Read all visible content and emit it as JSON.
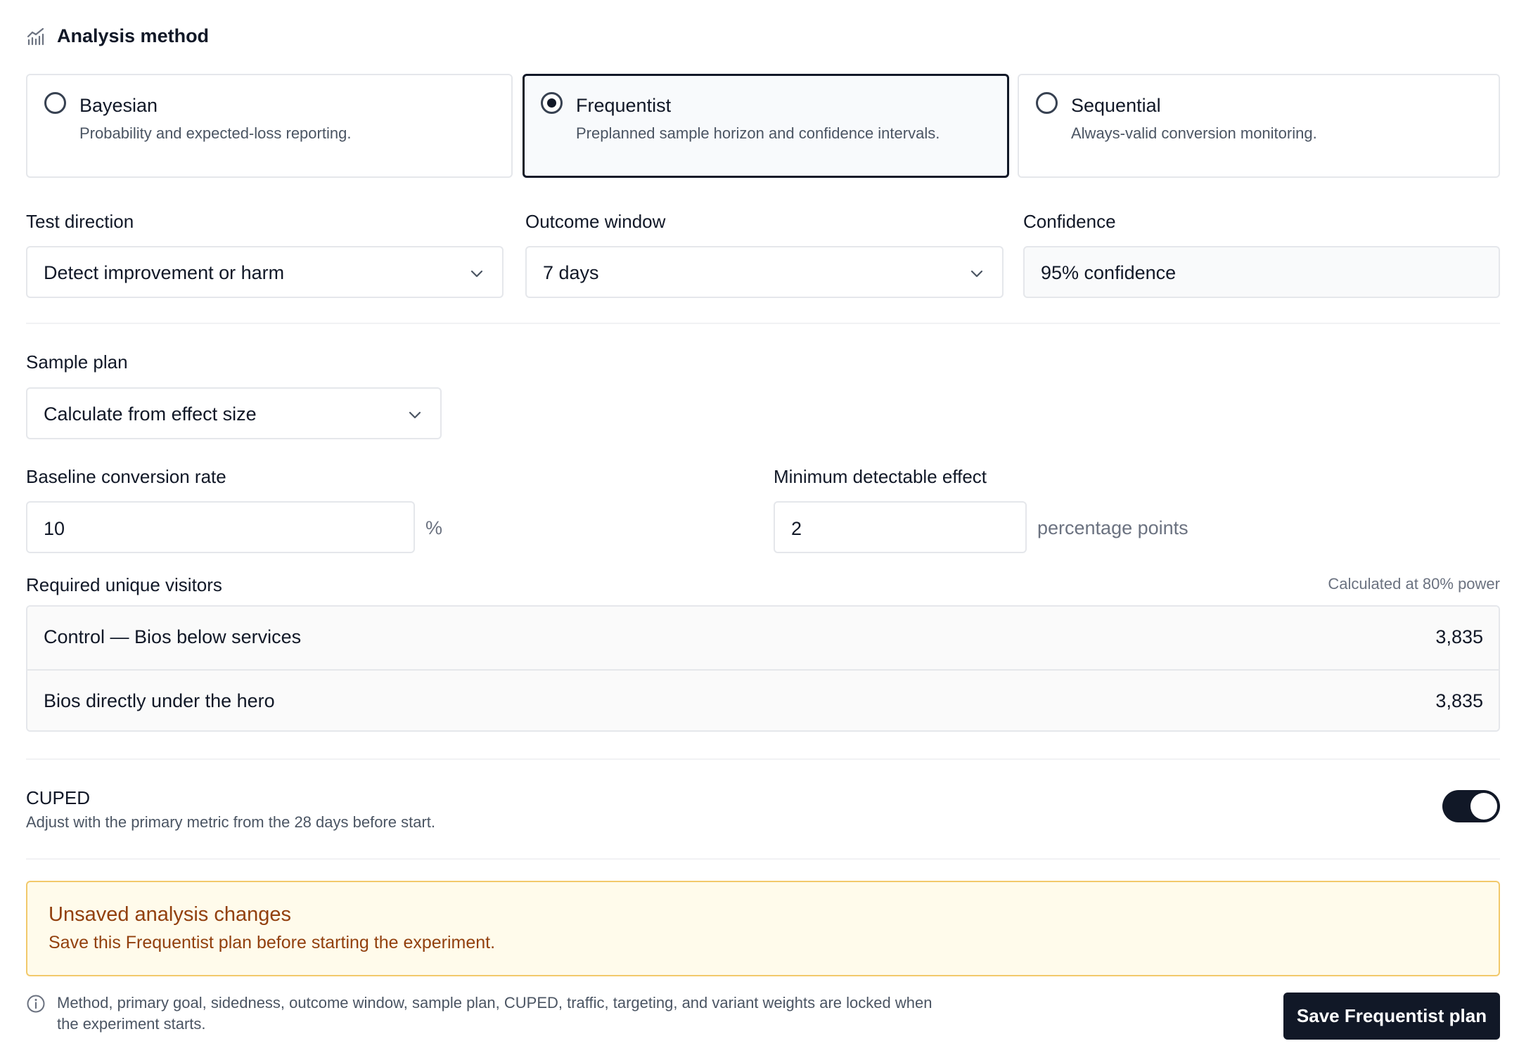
{
  "section": {
    "title": "Analysis method",
    "icon": "chart-icon"
  },
  "methods": [
    {
      "name": "Bayesian",
      "description": "Probability and expected-loss reporting.",
      "selected": false
    },
    {
      "name": "Frequentist",
      "description": "Preplanned sample horizon and confidence intervals.",
      "selected": true
    },
    {
      "name": "Sequential",
      "description": "Always-valid conversion monitoring.",
      "selected": false
    }
  ],
  "test_direction": {
    "label": "Test direction",
    "value": "Detect improvement or harm"
  },
  "outcome_window": {
    "label": "Outcome window",
    "value": "7 days"
  },
  "confidence": {
    "label": "Confidence",
    "value": "95% confidence"
  },
  "sample_plan": {
    "label": "Sample plan",
    "value": "Calculate from effect size"
  },
  "baseline": {
    "label": "Baseline conversion rate",
    "value": "10",
    "unit": "%"
  },
  "mde": {
    "label": "Minimum detectable effect",
    "value": "2",
    "unit": "percentage points"
  },
  "required_visitors": {
    "label": "Required unique visitors",
    "note": "Calculated at 80% power",
    "rows": [
      {
        "label": "Control — Bios below services",
        "value": "3,835"
      },
      {
        "label": "Bios directly under the hero",
        "value": "3,835"
      }
    ]
  },
  "cuped": {
    "title": "CUPED",
    "description": "Adjust with the primary metric from the 28 days before start.",
    "enabled": true
  },
  "warning": {
    "title": "Unsaved analysis changes",
    "text": "Save this Frequentist plan before starting the experiment."
  },
  "lock_note": "Method, primary goal, sidedness, outcome window, sample plan, CUPED, traffic, targeting, and variant weights are locked when the experiment starts.",
  "save_button": "Save Frequentist plan",
  "colors": {
    "primary": "#111827",
    "warning_bg": "#fffbeb",
    "warning_border": "#f2c96b",
    "warning_text": "#92400e",
    "muted_text": "#4b5563"
  }
}
